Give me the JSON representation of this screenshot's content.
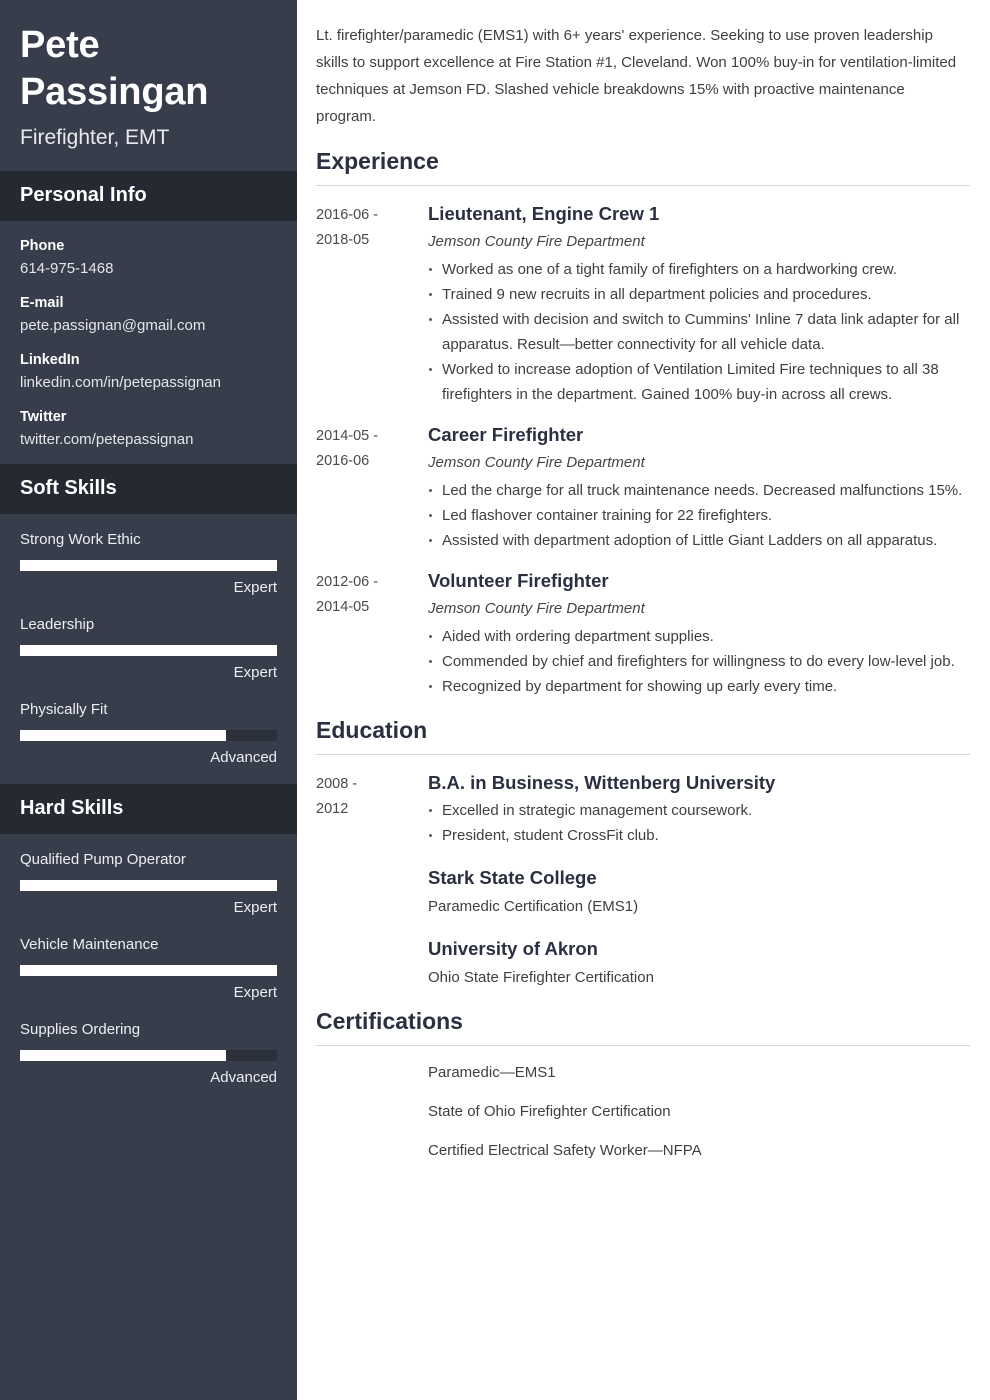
{
  "theme": {
    "sidebar_bg": "#373d4b",
    "sidebar_header_bg": "#242932",
    "bar_track": "#2b303b",
    "bar_fill": "#ffffff",
    "heading_color": "#2b3040",
    "rule_color": "#d8d8d8"
  },
  "sidebar": {
    "name": "Pete Passingan",
    "job_title": "Firefighter, EMT",
    "personal_info": {
      "heading": "Personal Info",
      "items": [
        {
          "label": "Phone",
          "value": "614-975-1468"
        },
        {
          "label": "E-mail",
          "value": "pete.passignan@gmail.com"
        },
        {
          "label": "LinkedIn",
          "value": "linkedin.com/in/petepassignan"
        },
        {
          "label": "Twitter",
          "value": "twitter.com/petepassignan"
        }
      ]
    },
    "soft_skills": {
      "heading": "Soft Skills",
      "items": [
        {
          "name": "Strong Work Ethic",
          "level": "Expert",
          "percent": 100
        },
        {
          "name": "Leadership",
          "level": "Expert",
          "percent": 100
        },
        {
          "name": "Physically Fit",
          "level": "Advanced",
          "percent": 80
        }
      ]
    },
    "hard_skills": {
      "heading": "Hard Skills",
      "items": [
        {
          "name": "Qualified Pump Operator",
          "level": "Expert",
          "percent": 100
        },
        {
          "name": "Vehicle Maintenance",
          "level": "Expert",
          "percent": 100
        },
        {
          "name": "Supplies Ordering",
          "level": "Advanced",
          "percent": 80
        }
      ]
    }
  },
  "main": {
    "summary": "Lt. firefighter/paramedic (EMS1) with 6+ years' experience. Seeking to use proven leadership skills to support excellence at Fire Station #1, Cleveland. Won 100% buy-in for ventilation-limited techniques at Jemson FD. Slashed vehicle breakdowns 15% with proactive maintenance program.",
    "experience": {
      "heading": "Experience",
      "entries": [
        {
          "date_start": "2016-06 -",
          "date_end": "2018-05",
          "title": "Lieutenant, Engine Crew 1",
          "org": "Jemson County Fire Department",
          "bullets": [
            "Worked as one of a tight family of firefighters on a hardworking crew.",
            "Trained 9 new recruits in all department policies and procedures.",
            "Assisted with decision and switch to Cummins' Inline 7 data link adapter for all apparatus. Result—better connectivity for all vehicle data.",
            "Worked to increase adoption of Ventilation Limited Fire techniques to all 38 firefighters in the department. Gained 100% buy-in across all crews."
          ]
        },
        {
          "date_start": "2014-05 -",
          "date_end": "2016-06",
          "title": "Career Firefighter",
          "org": "Jemson County Fire Department",
          "bullets": [
            "Led the charge for all truck maintenance needs. Decreased malfunctions 15%.",
            "Led flashover container training for 22 firefighters.",
            "Assisted with department adoption of Little Giant Ladders on all apparatus."
          ]
        },
        {
          "date_start": "2012-06 -",
          "date_end": "2014-05",
          "title": "Volunteer Firefighter",
          "org": "Jemson County Fire Department",
          "bullets": [
            "Aided with ordering department supplies.",
            "Commended by chief and firefighters for willingness to do every low-level job.",
            "Recognized by department for showing up early every time."
          ]
        }
      ]
    },
    "education": {
      "heading": "Education",
      "primary": {
        "date_start": "2008 -",
        "date_end": "2012",
        "title": "B.A. in Business, Wittenberg University",
        "bullets": [
          "Excelled in strategic management coursework.",
          "President, student CrossFit club."
        ]
      },
      "others": [
        {
          "title": "Stark State College",
          "note": "Paramedic Certification (EMS1)"
        },
        {
          "title": "University of Akron",
          "note": "Ohio State Firefighter Certification"
        }
      ]
    },
    "certifications": {
      "heading": "Certifications",
      "items": [
        "Paramedic—EMS1",
        "State of Ohio Firefighter Certification",
        "Certified Electrical Safety Worker—NFPA"
      ]
    }
  }
}
